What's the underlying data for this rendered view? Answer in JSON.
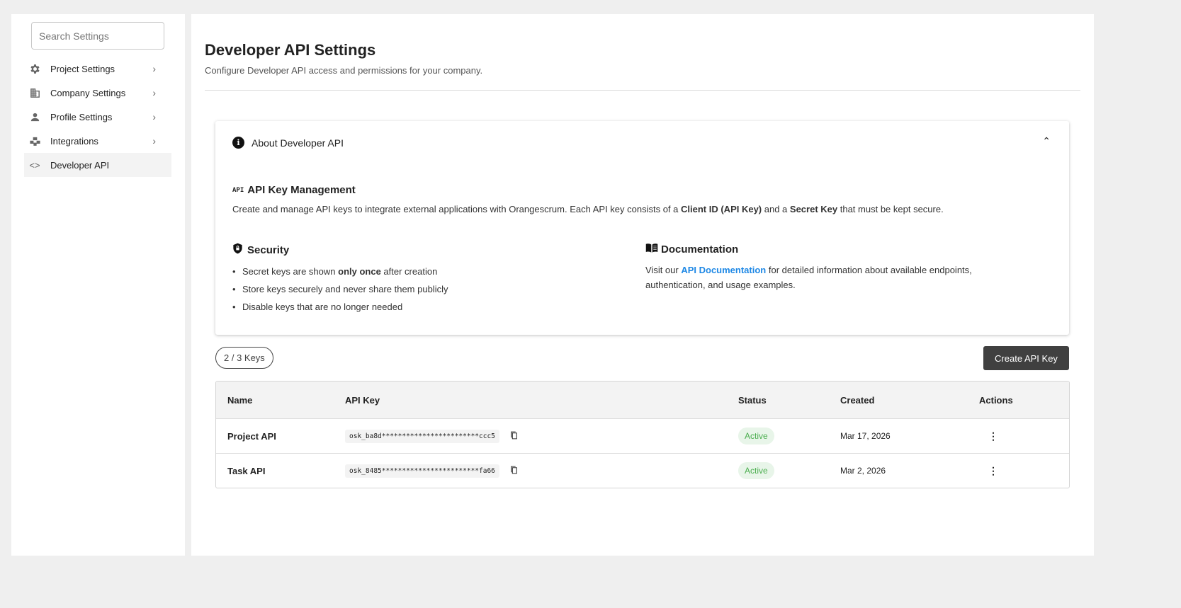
{
  "sidebar": {
    "search_placeholder": "Search Settings",
    "items": [
      {
        "label": "Project Settings",
        "icon": "gear-icon"
      },
      {
        "label": "Company Settings",
        "icon": "building-icon"
      },
      {
        "label": "Profile Settings",
        "icon": "person-icon"
      },
      {
        "label": "Integrations",
        "icon": "puzzle-icon"
      },
      {
        "label": "Developer API",
        "icon": "code-icon"
      }
    ]
  },
  "header": {
    "title": "Developer API Settings",
    "subtitle": "Configure Developer API access and permissions for your company."
  },
  "about": {
    "title": "About Developer API",
    "mgmt_icon": "API",
    "mgmt_title": "API Key Management",
    "mgmt_text_1": "Create and manage API keys to integrate external applications with Orangescrum. Each API key consists of a ",
    "mgmt_bold_1": "Client ID (API Key)",
    "mgmt_text_2": " and a ",
    "mgmt_bold_2": "Secret Key",
    "mgmt_text_3": " that must be kept secure.",
    "security_title": "Security",
    "security_1a": "Secret keys are shown ",
    "security_1b": "only once",
    "security_1c": " after creation",
    "security_2": "Store keys securely and never share them publicly",
    "security_3": "Disable keys that are no longer needed",
    "docs_title": "Documentation",
    "docs_text_1": "Visit our ",
    "docs_link": "API Documentation",
    "docs_text_2": " for detailed information about available endpoints, authentication, and usage examples."
  },
  "keys_count": "2 / 3 Keys",
  "create_button": "Create API Key",
  "table": {
    "headers": [
      "Name",
      "API Key",
      "Status",
      "Created",
      "Actions"
    ],
    "rows": [
      {
        "name": "Project API",
        "key": "osk_ba8d************************ccc5",
        "status": "Active",
        "created": "Mar 17, 2026"
      },
      {
        "name": "Task API",
        "key": "osk_8485************************fa66",
        "status": "Active",
        "created": "Mar 2, 2026"
      }
    ]
  },
  "colors": {
    "accent": "#1e88e5",
    "active": "#4caf50",
    "button": "#404040"
  }
}
